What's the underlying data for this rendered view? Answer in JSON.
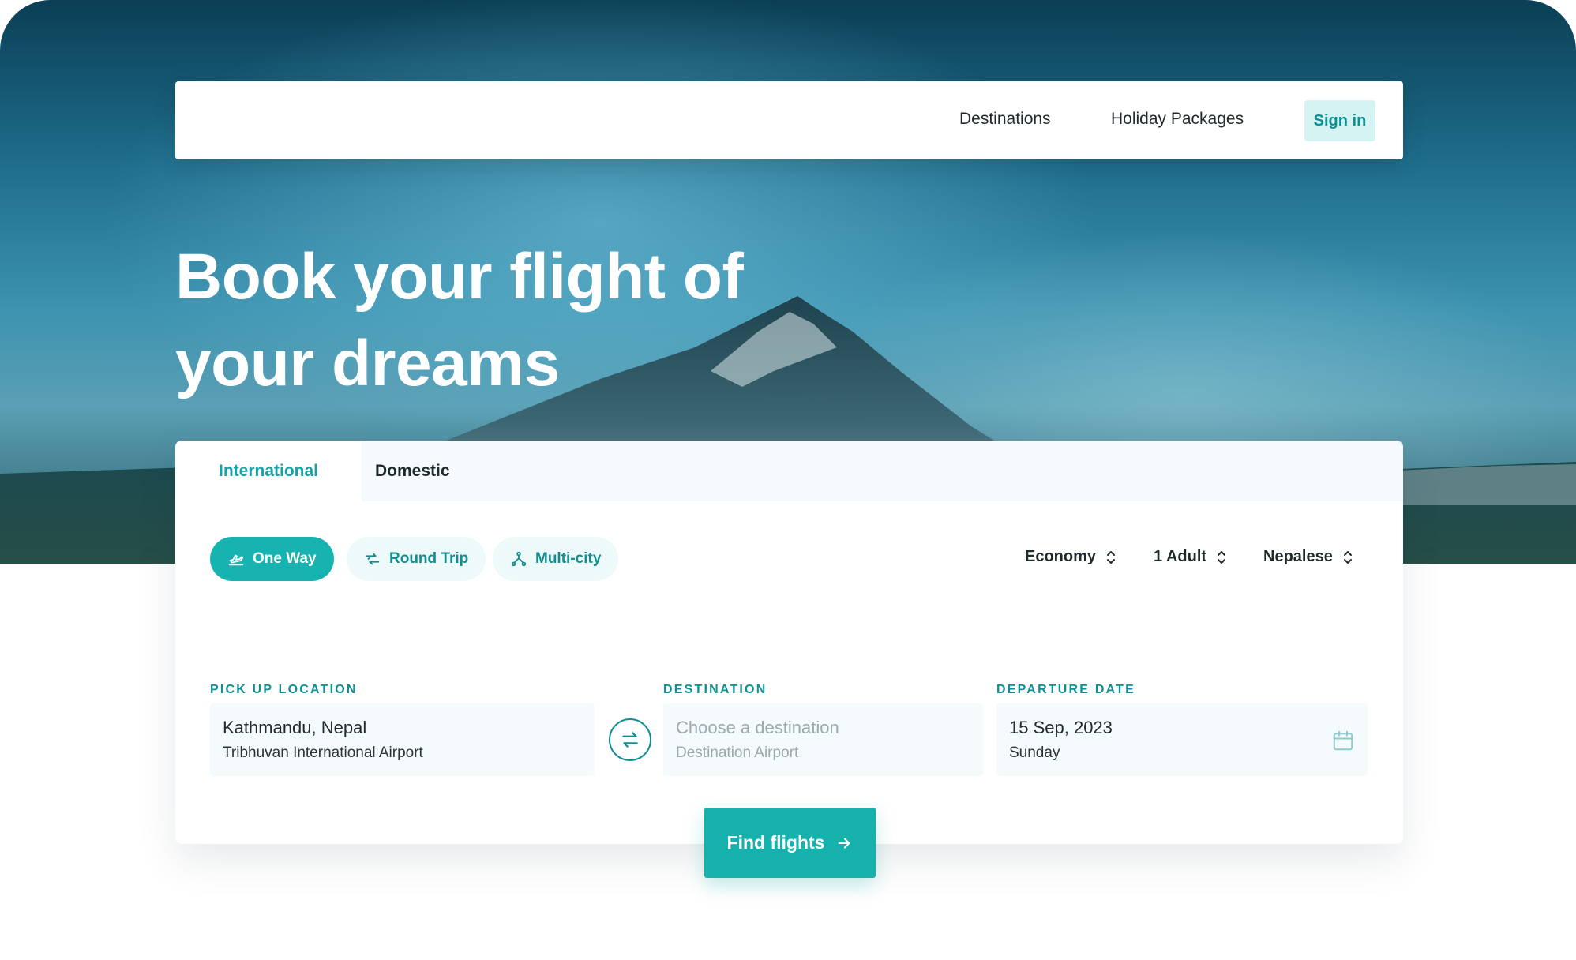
{
  "nav": {
    "destinations": "Destinations",
    "holiday_packages": "Holiday Packages",
    "sign_in": "Sign in"
  },
  "hero": {
    "headline_line1": "Book your flight of",
    "headline_line2": "your dreams"
  },
  "tabs": {
    "international": "International",
    "domestic": "Domestic",
    "active": "International"
  },
  "trip_types": {
    "one_way": "One Way",
    "round_trip": "Round Trip",
    "multi_city": "Multi-city",
    "selected": "One Way"
  },
  "selectors": {
    "cabin_class": "Economy",
    "passengers": "1 Adult",
    "nationality": "Nepalese"
  },
  "fields": {
    "pickup": {
      "label": "PICK UP LOCATION",
      "city": "Kathmandu, Nepal",
      "airport": "Tribhuvan International Airport"
    },
    "destination": {
      "label": "DESTINATION",
      "placeholder": "Choose a destination",
      "sub_placeholder": "Destination Airport"
    },
    "departure": {
      "label": "DEPARTURE DATE",
      "date": "15 Sep, 2023",
      "weekday": "Sunday"
    }
  },
  "cta": {
    "find_flights": "Find flights"
  },
  "colors": {
    "accent": "#16b0ad",
    "accent_dark": "#0e8f95",
    "accent_light": "#d6f3f3"
  },
  "icons": [
    "plane-takeoff-icon",
    "round-trip-icon",
    "multi-city-icon",
    "chevron-updown-icon",
    "swap-icon",
    "calendar-icon",
    "arrow-right-icon"
  ]
}
